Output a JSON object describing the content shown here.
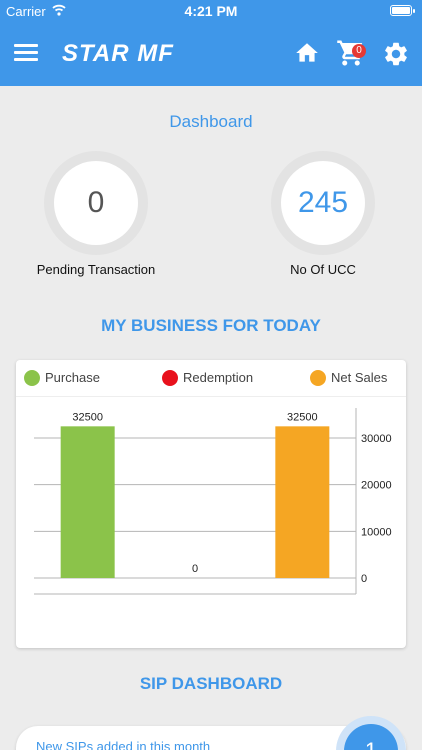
{
  "status_bar": {
    "carrier": "Carrier",
    "time": "4:21 PM"
  },
  "header": {
    "logo": "STAR MF",
    "cart_count": "0"
  },
  "dashboard": {
    "title": "Dashboard",
    "pending": {
      "value": "0",
      "label": "Pending Transaction"
    },
    "ucc": {
      "value": "245",
      "label": "No Of UCC"
    }
  },
  "business": {
    "title": "MY BUSINESS FOR TODAY"
  },
  "colors": {
    "primary": "#3f97e9",
    "purchase": "#8bc34a",
    "redemption": "#e8111c",
    "net_sales": "#f5a623"
  },
  "chart_data": {
    "type": "bar",
    "categories": [
      "Purchase",
      "Redemption",
      "Net Sales"
    ],
    "values": [
      32500,
      0,
      32500
    ],
    "data_labels": [
      "32500",
      "0",
      "32500"
    ],
    "legend": [
      {
        "name": "Purchase",
        "color": "#8bc34a"
      },
      {
        "name": "Redemption",
        "color": "#e8111c"
      },
      {
        "name": "Net Sales",
        "color": "#f5a623"
      }
    ],
    "legend_position": "top",
    "y_axis_position": "right",
    "yticks": [
      0,
      10000,
      20000,
      30000
    ],
    "ytick_labels": [
      "0",
      "10000",
      "20000",
      "30000"
    ],
    "ylim": [
      0,
      30000
    ],
    "grid": true
  },
  "sip": {
    "title": "SIP DASHBOARD",
    "new_sips_label": "New SIPs added in this month",
    "new_sips_count": "1"
  }
}
